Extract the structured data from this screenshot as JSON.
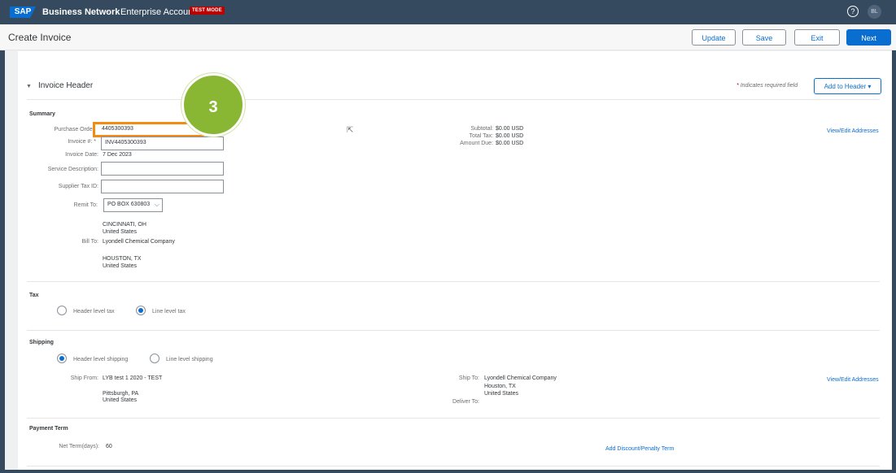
{
  "topbar": {
    "logo": "SAP",
    "brand": "Business Network",
    "brand_caret": "⌄",
    "account": "Enterprise Account",
    "test_badge": "TEST MODE",
    "help_icon": "?",
    "user_initials": "BL"
  },
  "toolbar": {
    "title": "Create Invoice",
    "update_label": "Update",
    "save_label": "Save",
    "exit_label": "Exit",
    "next_label": "Next"
  },
  "invoice_header": {
    "section_title": "Invoice Header",
    "required_note": "Indicates required field",
    "required_star": "*",
    "add_to_header_label": "Add to Header ▾"
  },
  "summary": {
    "heading": "Summary",
    "purchase_order_label": "Purchase Order:",
    "purchase_order_value": "4405300393",
    "invoice_no_label": "Invoice #: *",
    "invoice_no_value": "INV4405300393",
    "invoice_date_label": "Invoice Date:",
    "invoice_date_value": "7 Dec 2023",
    "service_desc_label": "Service Description:",
    "supplier_tax_label": "Supplier Tax ID:",
    "remit_to_label": "Remit To:",
    "remit_to_value": "PO BOX 630803",
    "remit_city": "CINCINNATI, OH",
    "remit_country": "United States",
    "bill_to_label": "Bill To:",
    "bill_to_name": "Lyondell Chemical Company",
    "bill_city": "HOUSTON, TX",
    "bill_country": "United States",
    "subtotal_label": "Subtotal:",
    "subtotal_value": "$0.00 USD",
    "total_tax_label": "Total Tax:",
    "total_tax_value": "$0.00 USD",
    "amount_due_label": "Amount Due:",
    "amount_due_value": "$0.00 USD",
    "view_edit_addresses": "View/Edit Addresses"
  },
  "tax": {
    "heading": "Tax",
    "header_level": "Header level tax",
    "line_level": "Line level tax"
  },
  "shipping": {
    "heading": "Shipping",
    "header_level": "Header level shipping",
    "line_level": "Line level shipping",
    "ship_from_label": "Ship From:",
    "ship_from_name": "LYB test 1 2020 - TEST",
    "ship_from_city": "Pittsburgh, PA",
    "ship_from_country": "United States",
    "ship_to_label": "Ship To:",
    "ship_to_name": "Lyondell Chemical Company",
    "ship_to_city": "Houston, TX",
    "ship_to_country": "United States",
    "deliver_to_label": "Deliver To:",
    "view_edit_addresses": "View/Edit Addresses"
  },
  "payment": {
    "heading": "Payment Term",
    "net_term_label": "Net Term(days):",
    "net_term_value": "60",
    "add_discount_link": "Add Discount/Penalty Term"
  },
  "step_badge": "3",
  "colors": {
    "shell": "#354a5f",
    "accent": "#0a6ed1",
    "highlight": "#f28a13",
    "badge": "#8ab733"
  }
}
